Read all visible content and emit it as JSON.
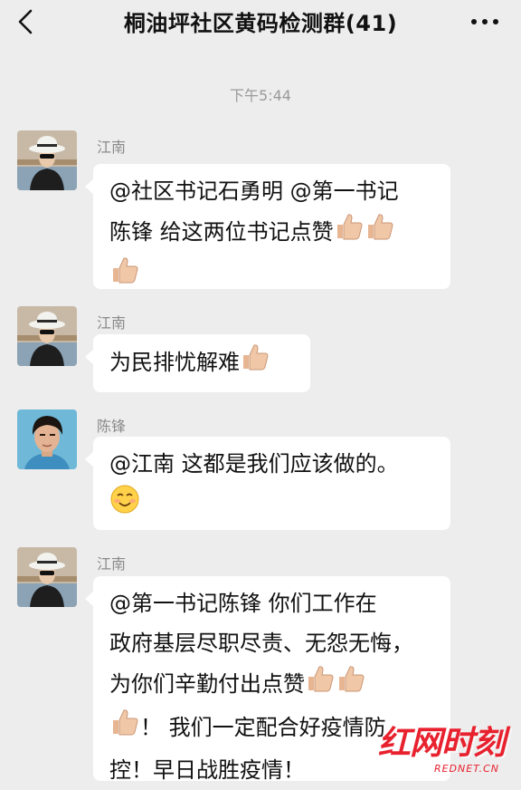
{
  "header": {
    "title": "桐油坪社区黄码检测群(41)",
    "back_icon": "chevron-left-icon",
    "more_icon": "more-dots-icon"
  },
  "timestamp": "下午5:44",
  "messages": [
    {
      "sender": "江南",
      "avatar": "woman-white-hat-sunglasses",
      "lines": [
        "@社区书记石勇明  @第一书记",
        "陈锋  给这两位书记点赞",
        ""
      ],
      "emoji": "thumbs-up-emoji"
    },
    {
      "sender": "江南",
      "avatar": "woman-white-hat-sunglasses",
      "lines": [
        "为民排忧解难"
      ],
      "emoji": "thumbs-up-emoji"
    },
    {
      "sender": "陈锋",
      "avatar": "man-portrait",
      "lines": [
        "@江南  这都是我们应该做的。",
        ""
      ],
      "emoji": "smiling-face-emoji"
    },
    {
      "sender": "江南",
      "avatar": "woman-white-hat-sunglasses",
      "lines": [
        "@第一书记陈锋  你们工作在",
        "政府基层尽职尽责、无怨无悔，",
        "为你们辛勤付出点赞",
        "！ 我们一定配合好疫情防",
        "控！早日战胜疫情！"
      ],
      "emoji": "thumbs-up-emoji"
    }
  ],
  "watermark": {
    "main": "红网时刻",
    "sub": "REDNET.CN"
  },
  "colors": {
    "background": "#ededed",
    "bubble": "#ffffff",
    "watermark": "#e8212e"
  }
}
